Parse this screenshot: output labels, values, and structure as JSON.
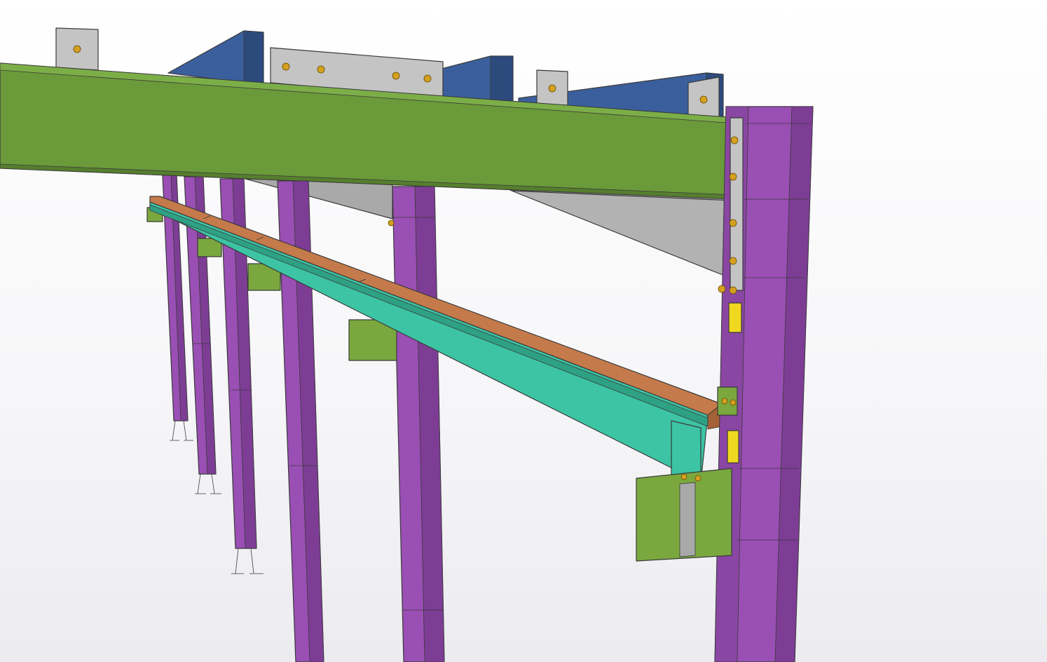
{
  "viewport": {
    "background_top": "#ffffff",
    "background_bottom": "#ececf0"
  },
  "colors": {
    "main_girder": "#6a9a3a",
    "main_girder_dark": "#567e2e",
    "roof_beam": "#3a5f9c",
    "roof_beam_dark": "#2c4a7c",
    "column": "#9a4fb4",
    "column_dark": "#7d3d95",
    "runway_beam": "#3cc4a4",
    "runway_beam_dark": "#2ea184",
    "rail_cap": "#c47a4a",
    "rail_cap_dark": "#a56238",
    "plate": "#a9a9a9",
    "plate_light": "#c4c4c4",
    "bracket": "#7aa83f",
    "bolt": "#d4a020",
    "shim": "#f0d820"
  },
  "icons": {
    "bolt": "bolt-icon",
    "anchor": "anchor-icon"
  }
}
